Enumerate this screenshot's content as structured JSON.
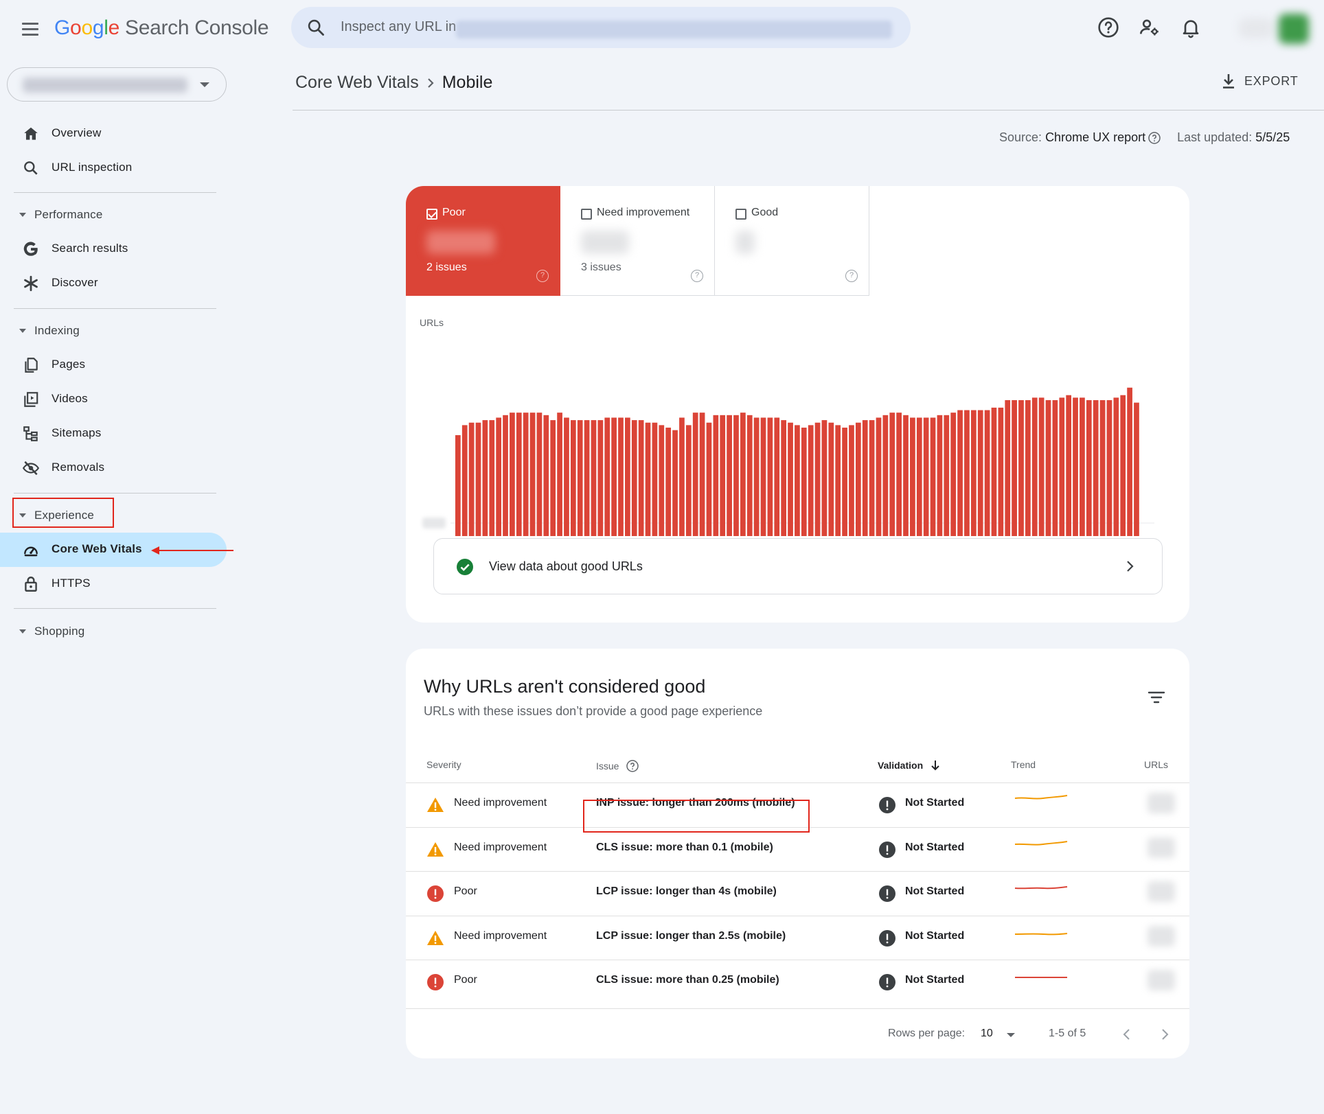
{
  "header": {
    "logo_google": [
      "G",
      "o",
      "o",
      "g",
      "l",
      "e"
    ],
    "logo_product": "Search Console",
    "search_placeholder": "Inspect any URL in"
  },
  "sidebar": {
    "overview": "Overview",
    "url_inspection": "URL inspection",
    "performance": "Performance",
    "search_results": "Search results",
    "discover": "Discover",
    "indexing": "Indexing",
    "pages": "Pages",
    "videos": "Videos",
    "sitemaps": "Sitemaps",
    "removals": "Removals",
    "experience": "Experience",
    "core_web_vitals": "Core Web Vitals",
    "https": "HTTPS",
    "shopping": "Shopping"
  },
  "page": {
    "breadcrumb_parent": "Core Web Vitals",
    "breadcrumb_current": "Mobile",
    "export_label": "EXPORT",
    "source_label": "Source:",
    "source_value": "Chrome UX report",
    "updated_label": "Last updated:",
    "updated_value": "5/5/25"
  },
  "status_tiles": [
    {
      "name": "Poor",
      "issues": "2 issues",
      "selected": true
    },
    {
      "name": "Need improvement",
      "issues": "3 issues",
      "selected": false
    },
    {
      "name": "Good",
      "issues": "",
      "selected": false
    }
  ],
  "chart_data": {
    "type": "bar",
    "ylabel": "URLs",
    "y_tick_visible": "0",
    "color": "#db4437",
    "values": [
      92,
      96,
      97,
      97,
      98,
      98,
      99,
      100,
      101,
      101,
      101,
      101,
      101,
      100,
      98,
      101,
      99,
      98,
      98,
      98,
      98,
      98,
      99,
      99,
      99,
      99,
      98,
      98,
      97,
      97,
      96,
      95,
      94,
      99,
      96,
      101,
      101,
      97,
      100,
      100,
      100,
      100,
      101,
      100,
      99,
      99,
      99,
      99,
      98,
      97,
      96,
      95,
      96,
      97,
      98,
      97,
      96,
      95,
      96,
      97,
      98,
      98,
      99,
      100,
      101,
      101,
      100,
      99,
      99,
      99,
      99,
      100,
      100,
      101,
      102,
      102,
      102,
      102,
      102,
      103,
      103,
      106,
      106,
      106,
      106,
      107,
      107,
      106,
      106,
      107,
      108,
      107,
      107,
      106,
      106,
      106,
      106,
      107,
      108,
      111,
      105
    ]
  },
  "good_link_label": "View data about good URLs",
  "issues": {
    "title": "Why URLs aren't considered good",
    "subtitle": "URLs with these issues don’t provide a good page experience",
    "columns": {
      "severity": "Severity",
      "issue": "Issue",
      "validation": "Validation",
      "trend": "Trend",
      "urls": "URLs"
    },
    "rows": [
      {
        "severity": "Need improvement",
        "issue": "INP issue: longer than 200ms (mobile)",
        "validation": "Not Started",
        "level": "warn"
      },
      {
        "severity": "Need improvement",
        "issue": "CLS issue: more than 0.1 (mobile)",
        "validation": "Not Started",
        "level": "warn"
      },
      {
        "severity": "Poor",
        "issue": "LCP issue: longer than 4s (mobile)",
        "validation": "Not Started",
        "level": "poor"
      },
      {
        "severity": "Need improvement",
        "issue": "LCP issue: longer than 2.5s (mobile)",
        "validation": "Not Started",
        "level": "warn"
      },
      {
        "severity": "Poor",
        "issue": "CLS issue: more than 0.25 (mobile)",
        "validation": "Not Started",
        "level": "poor"
      }
    ],
    "pagination": {
      "rows_per_page_label": "Rows per page:",
      "rows_per_page": "10",
      "range": "1-5 of 5"
    }
  },
  "colors": {
    "poor": "#db4437",
    "warn": "#f29900",
    "good": "#188038",
    "accent": "#c2e7ff"
  }
}
